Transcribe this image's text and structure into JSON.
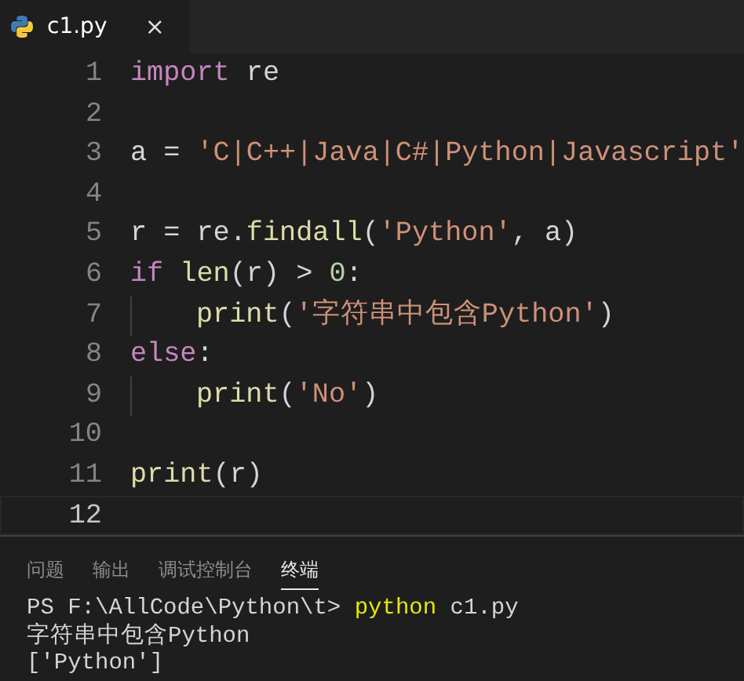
{
  "tabs": [
    {
      "label": "c1.py",
      "close": "×",
      "selected": true
    }
  ],
  "code_lines": [
    {
      "number": "1",
      "indented": false,
      "current": false,
      "tokens": [
        {
          "kind": "keyword",
          "text": "import"
        },
        {
          "kind": "plain",
          "text": " re"
        }
      ]
    },
    {
      "number": "2",
      "indented": false,
      "current": false
    },
    {
      "number": "3",
      "indented": false,
      "current": false,
      "tokens": [
        {
          "kind": "plain",
          "text": "a = "
        },
        {
          "kind": "string",
          "text": "'C|C++|Java|C#|Python|Javascript'"
        }
      ]
    },
    {
      "number": "4",
      "indented": false,
      "current": false
    },
    {
      "number": "5",
      "indented": false,
      "current": false,
      "tokens": [
        {
          "kind": "plain",
          "text": "r = re."
        },
        {
          "kind": "function",
          "text": "findall"
        },
        {
          "kind": "plain",
          "text": "("
        },
        {
          "kind": "string",
          "text": "'Python'"
        },
        {
          "kind": "plain",
          "text": ", a)"
        }
      ]
    },
    {
      "number": "6",
      "indented": false,
      "current": false,
      "tokens": [
        {
          "kind": "keyword",
          "text": "if"
        },
        {
          "kind": "function",
          "text": " len"
        },
        {
          "kind": "plain",
          "text": "(r) > "
        },
        {
          "kind": "number",
          "text": "0"
        },
        {
          "kind": "plain",
          "text": ":"
        }
      ]
    },
    {
      "number": "7",
      "indented": true,
      "current": false,
      "tokens": [
        {
          "kind": "function",
          "text": "print"
        },
        {
          "kind": "plain",
          "text": "("
        },
        {
          "kind": "string",
          "text": "'字符串中包含Python'"
        },
        {
          "kind": "plain",
          "text": ")"
        }
      ]
    },
    {
      "number": "8",
      "indented": false,
      "current": false,
      "tokens": [
        {
          "kind": "keyword",
          "text": "else"
        },
        {
          "kind": "plain",
          "text": ":"
        }
      ]
    },
    {
      "number": "9",
      "indented": true,
      "current": false,
      "tokens": [
        {
          "kind": "function",
          "text": "print"
        },
        {
          "kind": "plain",
          "text": "("
        },
        {
          "kind": "string",
          "text": "'No'"
        },
        {
          "kind": "plain",
          "text": ")"
        }
      ]
    },
    {
      "number": "10",
      "indented": false,
      "current": false
    },
    {
      "number": "11",
      "indented": false,
      "current": false,
      "tokens": [
        {
          "kind": "function",
          "text": "print"
        },
        {
          "kind": "plain",
          "text": "(r)"
        }
      ]
    },
    {
      "number": "12",
      "indented": false,
      "current": true
    }
  ],
  "panel_tabs": [
    {
      "label": "问题",
      "selected": false
    },
    {
      "label": "输出",
      "selected": false
    },
    {
      "label": "调试控制台",
      "selected": false
    },
    {
      "label": "终端",
      "selected": true
    }
  ],
  "terminal_lines": [
    {
      "tokens": [
        {
          "kind": "plain",
          "text": "PS F:\\AllCode\\Python\\t> "
        },
        {
          "kind": "command",
          "text": "python"
        },
        {
          "kind": "plain",
          "text": " c1.py"
        }
      ]
    },
    {
      "tokens": [
        {
          "kind": "plain",
          "text": "字符串中包含Python"
        }
      ]
    },
    {
      "tokens": [
        {
          "kind": "plain",
          "text": "['Python']"
        }
      ]
    }
  ]
}
